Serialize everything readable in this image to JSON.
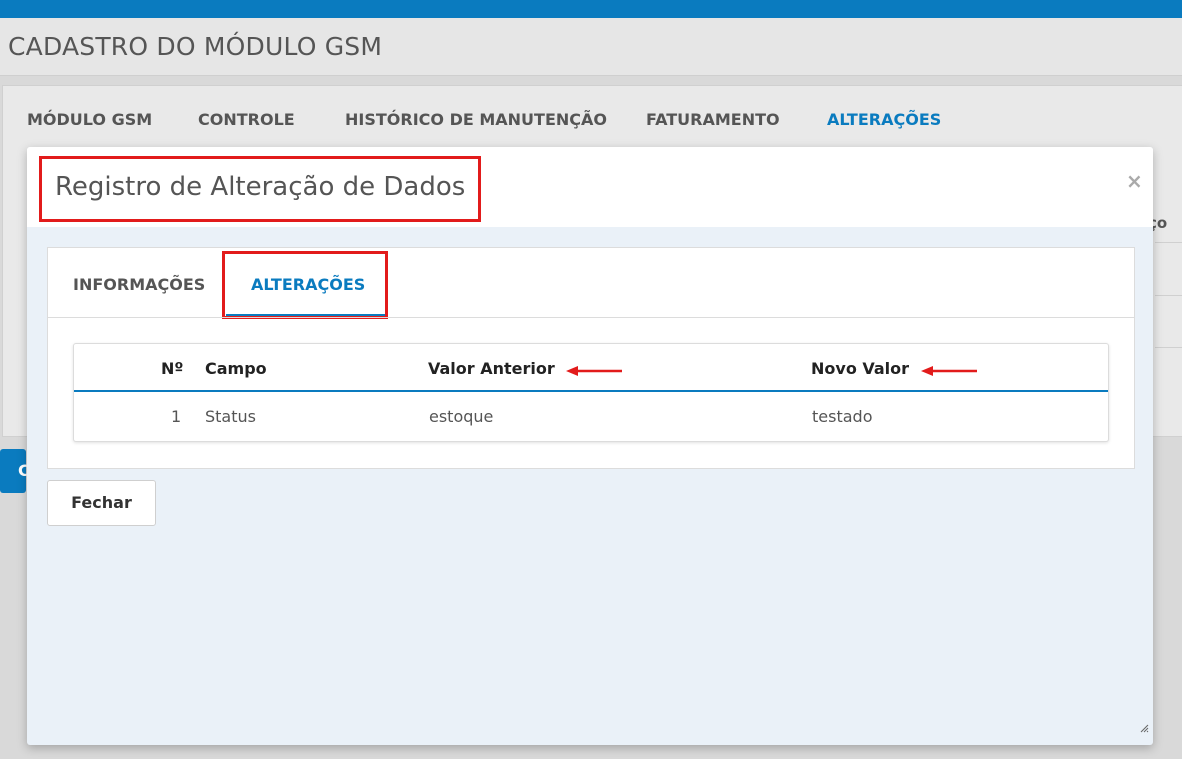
{
  "page": {
    "title": "CADASTRO DO MÓDULO GSM"
  },
  "main_tabs": [
    {
      "label": "MÓDULO GSM"
    },
    {
      "label": "CONTROLE"
    },
    {
      "label": "HISTÓRICO DE MANUTENÇÃO"
    },
    {
      "label": "FATURAMENTO"
    },
    {
      "label": "ALTERAÇÕES",
      "active": true
    }
  ],
  "background": {
    "partial_header": "ço",
    "partial_button": "C"
  },
  "modal": {
    "title": "Registro de Alteração de Dados",
    "close": "×",
    "tabs": [
      {
        "label": "INFORMAÇÕES"
      },
      {
        "label": "ALTERAÇÕES",
        "active": true
      }
    ],
    "table": {
      "headers": {
        "num": "Nº",
        "campo": "Campo",
        "valor_anterior": "Valor Anterior",
        "novo_valor": "Novo Valor"
      },
      "rows": [
        {
          "num": "1",
          "campo": "Status",
          "valor_anterior": "estoque",
          "novo_valor": "testado"
        }
      ]
    },
    "close_button": "Fechar"
  },
  "colors": {
    "accent": "#0a7bbf",
    "highlight": "#e21b1b"
  }
}
